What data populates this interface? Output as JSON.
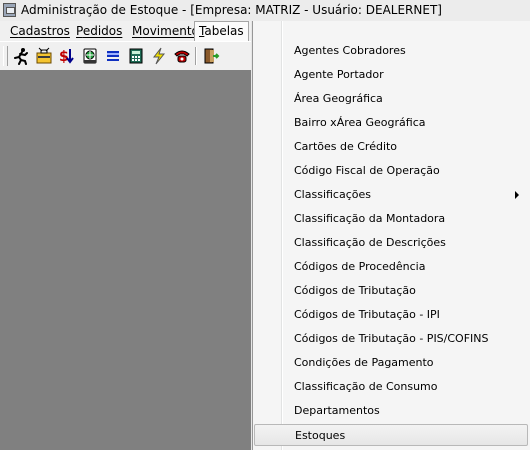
{
  "window": {
    "title": "Administração de Estoque - [Empresa: MATRIZ - Usuário: DEALERNET]"
  },
  "menubar": {
    "items": [
      {
        "first": "C",
        "rest": "adastros"
      },
      {
        "first": "P",
        "rest": "edidos"
      },
      {
        "first": "M",
        "rest": "ovimento"
      },
      {
        "first": "T",
        "rest": "abelas"
      }
    ]
  },
  "toolbar": {
    "icons": [
      "running-man-icon",
      "briefcase-icon",
      "currency-transfer-icon",
      "globe-icon",
      "list-icon",
      "calculator-icon",
      "lightning-icon",
      "telephone-icon",
      "exit-door-icon"
    ]
  },
  "tabelas_menu": {
    "items": [
      {
        "label": "Agentes Cobradores"
      },
      {
        "label": "Agente Portador"
      },
      {
        "label": "Área Geográfica"
      },
      {
        "label": "Bairro xÁrea Geográfica"
      },
      {
        "label": "Cartões de Crédito"
      },
      {
        "label": "Código Fiscal de Operação"
      },
      {
        "label": "Classificações",
        "has_submenu": true
      },
      {
        "label": "Classificação da Montadora"
      },
      {
        "label": "Classificação de Descrições"
      },
      {
        "label": "Códigos de Procedência"
      },
      {
        "label": "Códigos de Tributação"
      },
      {
        "label": "Códigos de Tributação - IPI"
      },
      {
        "label": "Códigos de Tributação - PIS/COFINS"
      },
      {
        "label": "Condições de Pagamento"
      },
      {
        "label": "Classificação de Consumo"
      },
      {
        "label": "Departamentos"
      },
      {
        "label": "Estoques",
        "highlighted": true
      }
    ]
  },
  "colors": {
    "workspace": "#808080",
    "menu_background": "#f5f5f5"
  }
}
